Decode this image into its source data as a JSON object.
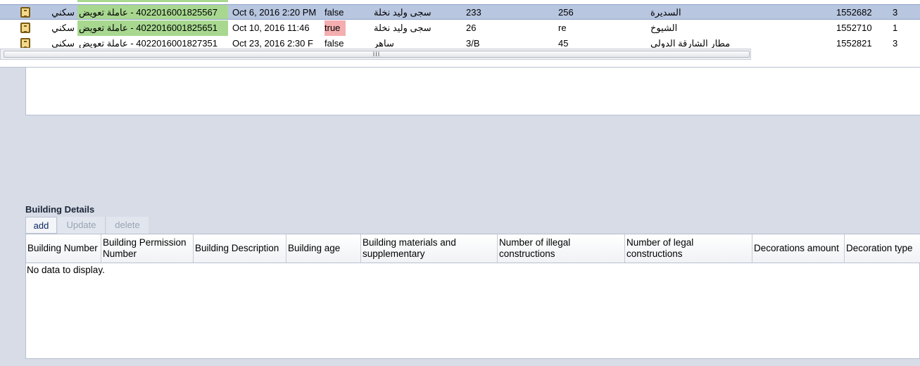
{
  "grid": {
    "rows": [
      {
        "type": "سكني",
        "tx": "4022016001825567 - عاملة تعويض",
        "date": "Oct 6, 2016 2:20 PM",
        "flag": "false",
        "name": "سجى وليد نخلة",
        "a": "233",
        "b": "256",
        "area": "السديرة",
        "id": "1552682",
        "n": "3",
        "selected": true,
        "highlight_tx": true
      },
      {
        "type": "سكني",
        "tx": "4022016001825651 - عاملة تعويض",
        "date": "Oct 10, 2016 11:46",
        "flag": "true",
        "name": "سجى وليد نخلة",
        "a": "26",
        "b": "re",
        "area": "الشيوخ",
        "id": "1552710",
        "n": "1",
        "selected": false,
        "highlight_tx": true
      },
      {
        "type": "سكني",
        "tx": "4022016001827351 - عاملة تعويض",
        "date": "Oct 23, 2016 2:30 F",
        "flag": "false",
        "name": "ساهر",
        "a": "3/B",
        "b": "45",
        "area": "مطار الشارقة الدولي",
        "id": "1552821",
        "n": "3",
        "selected": false,
        "highlight_tx": false
      }
    ],
    "scroll_grip": "III"
  },
  "building_details": {
    "title": "Building Details",
    "toolbar": {
      "add": "add",
      "update": "Update",
      "delete": "delete"
    },
    "columns": [
      "Building Number",
      "Building Permission Number",
      "Building Description",
      "Building age",
      "Building materials and supplementary",
      "Number of illegal constructions",
      "Number of legal constructions",
      "Decorations amount",
      "Decoration type"
    ],
    "empty_message": "No data to display."
  },
  "colors": {
    "selected_row": "#b8c6e0",
    "highlight_green": "#a8d890",
    "true_flag": "#f4aeb0"
  }
}
